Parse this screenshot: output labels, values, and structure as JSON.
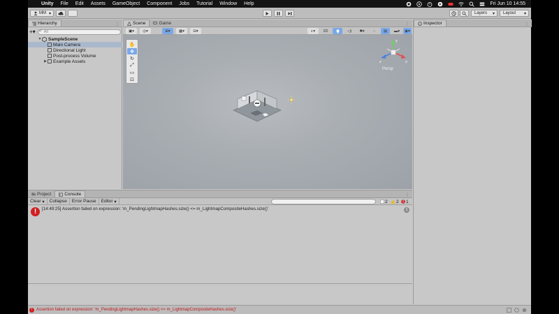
{
  "menubar": {
    "app": "Unity",
    "items": [
      "File",
      "Edit",
      "Assets",
      "GameObject",
      "Component",
      "Jobs",
      "Tutorial",
      "Window",
      "Help"
    ],
    "clock": "Fri Jun 10  14:55"
  },
  "toolbar": {
    "account": "MM",
    "layers": "Layers",
    "layout": "Layout"
  },
  "hierarchy": {
    "tab": "Hierarchy",
    "search_placeholder": "All",
    "scene": "SampleScene",
    "items": [
      "Main Camera",
      "Directional Light",
      "Post-process Volume",
      "Example Assets"
    ]
  },
  "scene": {
    "tabs": [
      "Scene",
      "Game"
    ],
    "mode_2d": "2D",
    "gizmo_label": "Persp",
    "gizmo_axes": {
      "y": "y",
      "x": "x",
      "z": "z"
    }
  },
  "inspector": {
    "tab": "Inspector"
  },
  "console": {
    "tabs": [
      "Project",
      "Console"
    ],
    "toolbar": {
      "clear": "Clear",
      "collapse": "Collapse",
      "error_pause": "Error Pause",
      "editor": "Editor"
    },
    "counts": {
      "messages": "2",
      "warnings": "2",
      "errors": "1"
    },
    "entry": {
      "text": "[14:49:25] Assertion failed on expression: 'm_PendingLightmapHashes.size() <= m_LightmapCompositeHashes.size()'",
      "count": "1"
    }
  },
  "statusbar": {
    "message": "Assertion failed on expression: 'm_PendingLightmapHashes.size() <= m_LightmapCompositeHashes.size()'"
  },
  "colors": {
    "error": "#d02020",
    "selection": "#7aa7e8",
    "panel": "#c8c8c8"
  }
}
